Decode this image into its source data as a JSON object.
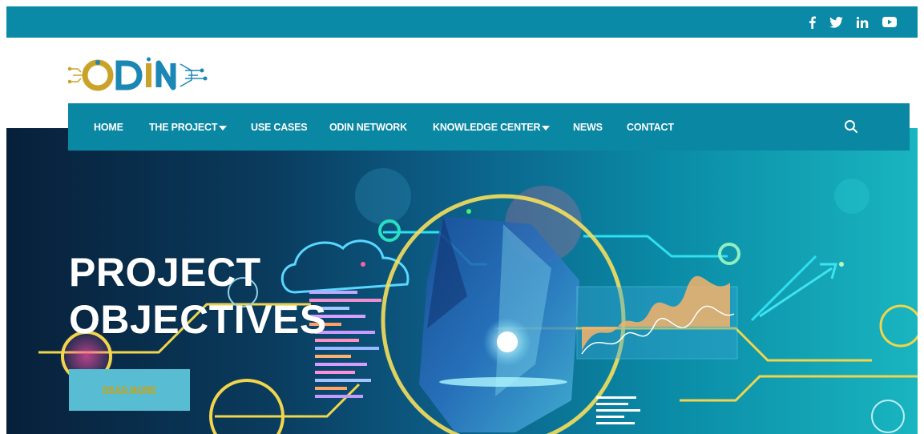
{
  "topbar": {
    "social": [
      {
        "icon": "facebook-icon",
        "glyph": "f"
      },
      {
        "icon": "twitter-icon",
        "glyph": "🐦"
      },
      {
        "icon": "linkedin-icon",
        "glyph": "in"
      },
      {
        "icon": "youtube-icon",
        "glyph": "▶"
      }
    ]
  },
  "logo": {
    "text": "ODIN"
  },
  "nav": {
    "items": [
      {
        "label": "HOME",
        "dropdown": false
      },
      {
        "label": "THE PROJECT",
        "dropdown": true
      },
      {
        "label": "USE CASES",
        "dropdown": false
      },
      {
        "label": "ODIN NETWORK",
        "dropdown": false
      },
      {
        "label": "KNOWLEDGE CENTER",
        "dropdown": true
      },
      {
        "label": "NEWS",
        "dropdown": false
      },
      {
        "label": "CONTACT",
        "dropdown": false
      }
    ],
    "search_icon": "search-icon"
  },
  "hero": {
    "title_line1": "PROJECT",
    "title_line2": "OBJECTIVES",
    "button_label": "READ MORE"
  },
  "colors": {
    "brand_teal": "#0a8aa7",
    "button": "#58bdd3",
    "button_text": "#c8a418",
    "logo_gold": "#c9a227",
    "logo_blue": "#1b87b5"
  }
}
